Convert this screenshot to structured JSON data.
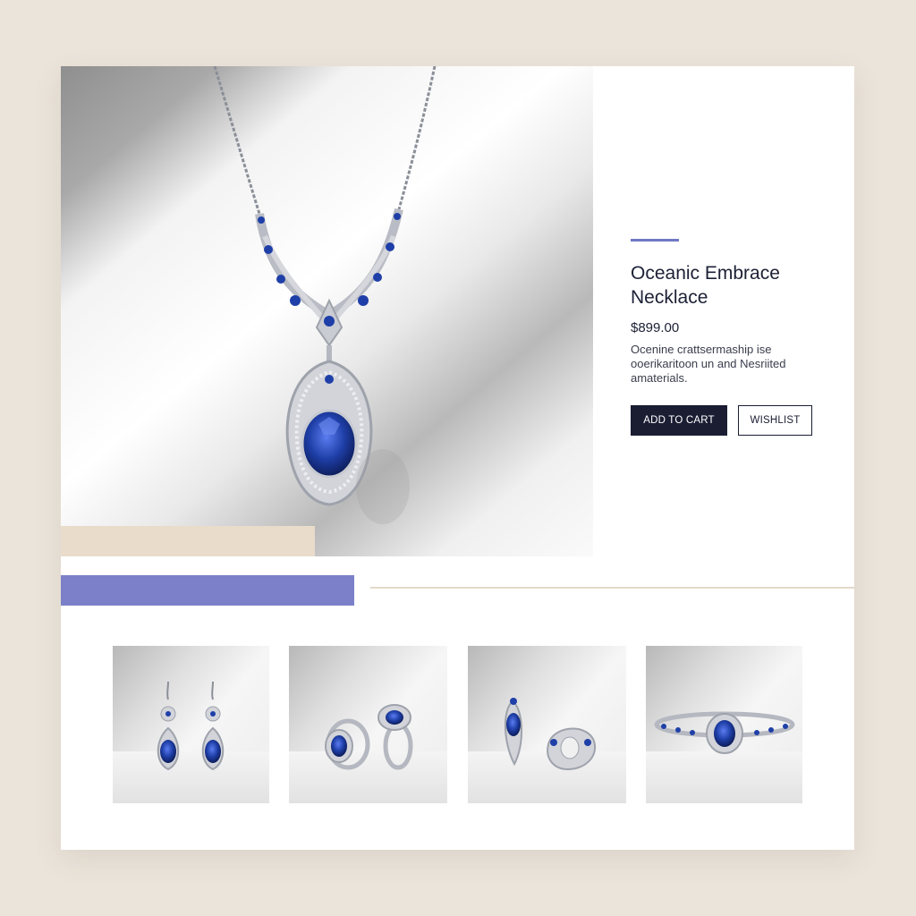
{
  "product": {
    "title": "Oceanic Embrace Necklace",
    "price": "$899.00",
    "description": "Ocenine crattsermaship ise ooerikaritoon un and Nesriited amaterials.",
    "add_to_cart_label": "ADD TO CART",
    "wishlist_label": "WISHLIST"
  },
  "gallery": {
    "items": [
      {
        "name": "sapphire-drop-earrings"
      },
      {
        "name": "sapphire-halo-rings"
      },
      {
        "name": "sapphire-open-rings"
      },
      {
        "name": "sapphire-band-ring"
      }
    ]
  },
  "colors": {
    "background": "#ebe4da",
    "card": "#ffffff",
    "accent_violet": "#7b80c8",
    "beige_block": "#e9dccb",
    "button_dark": "#1b1d33",
    "sapphire": "#1f3fa8"
  }
}
